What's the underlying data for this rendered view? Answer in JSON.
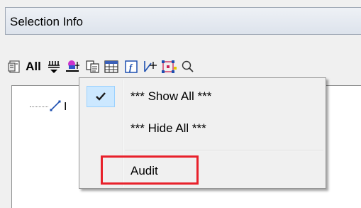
{
  "window": {
    "title": "Selection Info"
  },
  "toolbar": {
    "buttons": [
      {
        "icon": "properties-icon"
      },
      {
        "icon": "all-text-icon",
        "label": "All"
      },
      {
        "icon": "filter-dropdown-icon"
      },
      {
        "icon": "highlight-icon"
      },
      {
        "icon": "copy-icon"
      },
      {
        "icon": "table-icon"
      },
      {
        "icon": "function-icon"
      },
      {
        "icon": "pick-point-icon"
      },
      {
        "icon": "select-grips-icon"
      },
      {
        "icon": "zoom-icon"
      }
    ]
  },
  "tree": {
    "items": [
      {
        "label": "I"
      }
    ]
  },
  "context_menu": {
    "items": [
      {
        "label": "*** Show All ***",
        "checked": true
      },
      {
        "label": "*** Hide All ***",
        "checked": false
      },
      {
        "label": "Audit",
        "checked": false
      }
    ]
  },
  "colors": {
    "highlight_border": "#e8212b",
    "check_bg": "#cce8ff",
    "check_border": "#99d1ff"
  }
}
